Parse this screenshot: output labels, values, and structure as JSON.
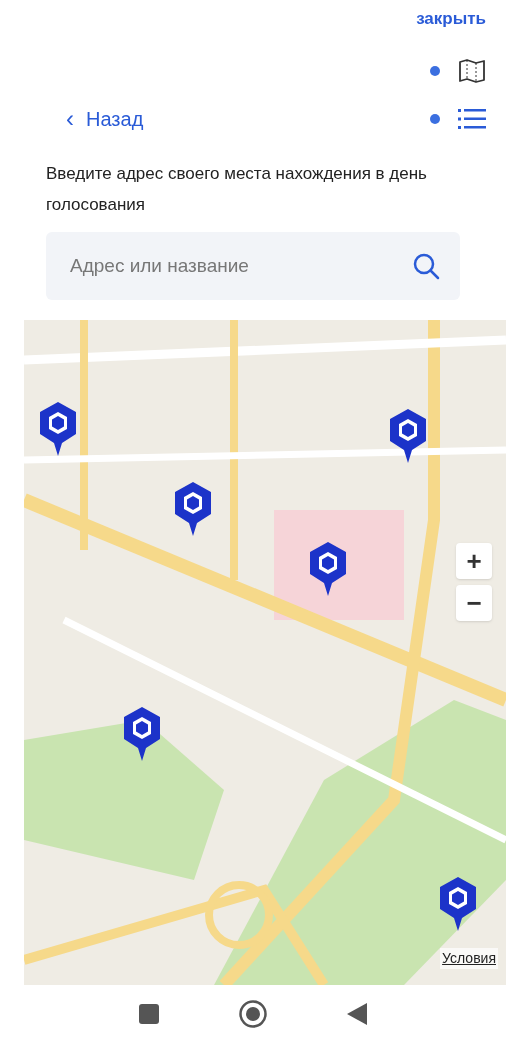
{
  "close_link": "закрыть",
  "view_toggles": [
    {
      "kind": "map",
      "indicator": true
    },
    {
      "kind": "list",
      "indicator": true
    }
  ],
  "back_link": {
    "icon": "‹",
    "label": "Назад"
  },
  "instruction": "Введите адрес своего места нахождения в день голосования",
  "search": {
    "placeholder": "Адрес или название"
  },
  "map": {
    "kind": "picture",
    "zoom_in": "+",
    "zoom_out": "−",
    "terms_link": "Условия"
  }
}
